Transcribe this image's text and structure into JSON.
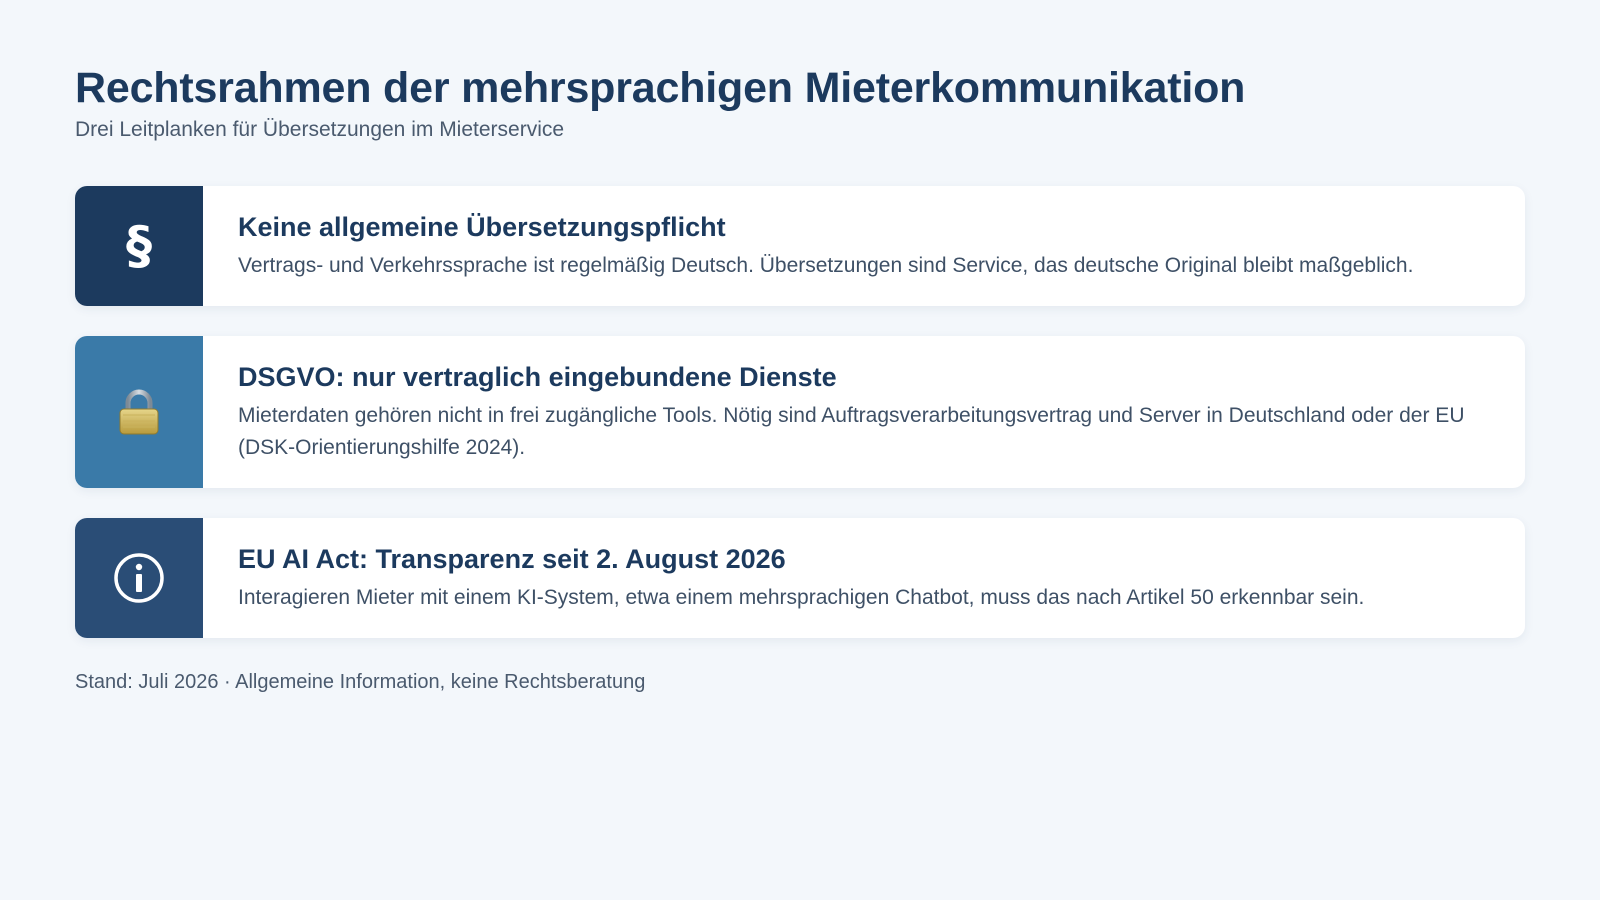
{
  "header": {
    "title": "Rechtsrahmen der mehrsprachigen Mieterkommunikation",
    "subtitle": "Drei Leitplanken für Übersetzungen im Mieterservice"
  },
  "cards": [
    {
      "icon": "paragraph-icon",
      "icon_glyph": "§",
      "accent": "#1c3a5e",
      "title": "Keine allgemeine Übersetzungspflicht",
      "text": "Vertrags- und Verkehrssprache ist regelmäßig Deutsch. Übersetzungen sind Service, das deutsche Original bleibt maßgeblich."
    },
    {
      "icon": "lock-icon",
      "accent": "#3a7aa8",
      "title": "DSGVO: nur vertraglich eingebundene Dienste",
      "text": "Mieterdaten gehören nicht in frei zugängliche Tools. Nötig sind Auftragsverarbeitungsvertrag und Server in Deutschland oder der EU (DSK-Orientierungshilfe 2024)."
    },
    {
      "icon": "info-icon",
      "accent": "#2a4d76",
      "title": "EU AI Act: Transparenz seit 2. August 2026",
      "text": "Interagieren Mieter mit einem KI-System, etwa einem mehrsprachigen Chatbot, muss das nach Artikel 50 erkennbar sein."
    }
  ],
  "footer": {
    "note": "Stand: Juli 2026 · Allgemeine Information, keine Rechtsberatung"
  }
}
